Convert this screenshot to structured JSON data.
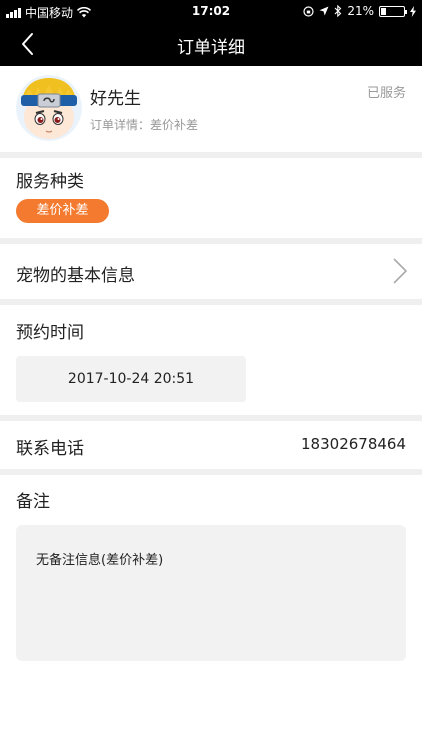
{
  "status_bar": {
    "carrier": "中国移动",
    "time": "17:02",
    "battery_percent": "21%",
    "battery_level": 0.21,
    "icons": [
      "signal-icon",
      "wifi-icon",
      "lock-rotation-icon",
      "location-icon",
      "bluetooth-icon",
      "battery-icon",
      "charging-icon"
    ]
  },
  "nav": {
    "title": "订单详细",
    "back_icon": "chevron-left-icon"
  },
  "user": {
    "name": "好先生",
    "detail": "订单详情：差价补差",
    "status": "已服务"
  },
  "service": {
    "title": "服务种类",
    "tag": "差价补差",
    "tag_color": "#f37a2e"
  },
  "pet": {
    "title": "宠物的基本信息",
    "chevron_icon": "chevron-right-icon"
  },
  "appointment": {
    "title": "预约时间",
    "value": "2017-10-24 20:51"
  },
  "contact": {
    "title": "联系电话",
    "value": "18302678464"
  },
  "remark": {
    "title": "备注",
    "value": "无备注信息(差价补差)"
  },
  "colors": {
    "header_bg": "#000000",
    "accent": "#f37a2e",
    "divider": "#efefef",
    "box_bg": "#f2f2f2"
  }
}
